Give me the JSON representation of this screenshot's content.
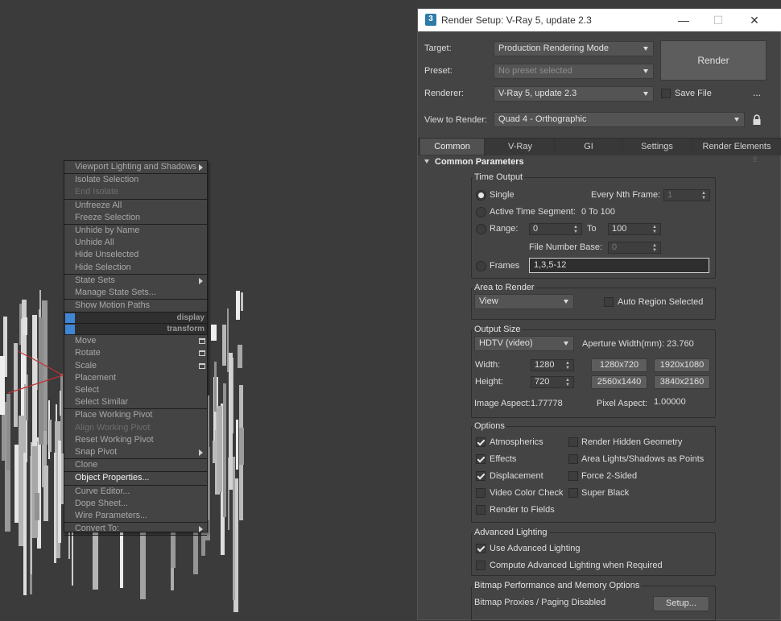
{
  "context_menu": {
    "sections": [
      [
        {
          "label": "Viewport Lighting and Shadows",
          "state": "normal",
          "arrow": true
        }
      ],
      [
        {
          "label": "Isolate Selection",
          "state": "normal"
        },
        {
          "label": "End Isolate",
          "state": "disabled"
        }
      ],
      [
        {
          "label": "Unfreeze All",
          "state": "normal"
        },
        {
          "label": "Freeze Selection",
          "state": "normal"
        }
      ],
      [
        {
          "label": "Unhide by Name",
          "state": "normal"
        },
        {
          "label": "Unhide All",
          "state": "normal"
        },
        {
          "label": "Hide Unselected",
          "state": "normal"
        },
        {
          "label": "Hide Selection",
          "state": "normal"
        }
      ],
      [
        {
          "label": "State Sets",
          "state": "normal",
          "arrow": true
        },
        {
          "label": "Manage State Sets...",
          "state": "normal"
        }
      ],
      [
        {
          "label": "Show Motion Paths",
          "state": "normal"
        }
      ]
    ],
    "band_display": "display",
    "band_transform": "transform",
    "sections2": [
      [
        {
          "label": "Move",
          "state": "normal",
          "box": true
        },
        {
          "label": "Rotate",
          "state": "normal",
          "box": true
        },
        {
          "label": "Scale",
          "state": "normal",
          "box": true
        },
        {
          "label": "Placement",
          "state": "normal"
        },
        {
          "label": "Select",
          "state": "normal"
        },
        {
          "label": "Select Similar",
          "state": "normal"
        }
      ],
      [
        {
          "label": "Place Working Pivot",
          "state": "normal"
        },
        {
          "label": "Align Working Pivot",
          "state": "disabled"
        },
        {
          "label": "Reset Working Pivot",
          "state": "normal"
        },
        {
          "label": "Snap Pivot",
          "state": "normal",
          "arrow": true
        }
      ],
      [
        {
          "label": "Clone",
          "state": "normal"
        }
      ],
      [
        {
          "label": "Object Properties...",
          "state": "highlight"
        }
      ],
      [
        {
          "label": "Curve Editor...",
          "state": "normal"
        },
        {
          "label": "Dope Sheet...",
          "state": "normal"
        },
        {
          "label": "Wire Parameters...",
          "state": "normal"
        }
      ],
      [
        {
          "label": "Convert To:",
          "state": "normal",
          "arrow": true
        }
      ]
    ]
  },
  "dialog": {
    "app_icon": "3",
    "title": "Render Setup: V-Ray 5, update 2.3",
    "win_min": "—",
    "win_max": "☐",
    "win_close": "✕",
    "target_label": "Target:",
    "target_value": "Production Rendering Mode",
    "preset_label": "Preset:",
    "preset_value": "No preset selected",
    "renderer_label": "Renderer:",
    "renderer_value": "V-Ray 5, update 2.3",
    "render_button": "Render",
    "save_file_label": "Save File",
    "more_button": "...",
    "view_label": "View to Render:",
    "view_value": "Quad 4 - Orthographic",
    "tabs": [
      "Common",
      "V-Ray",
      "GI",
      "Settings",
      "Render Elements"
    ],
    "rollout_title": "Common Parameters",
    "time_output": {
      "title": "Time Output",
      "single": "Single",
      "every_nth": "Every Nth Frame:",
      "every_nth_value": "1",
      "active_segment": "Active Time Segment:",
      "active_segment_value": "0 To 100",
      "range": "Range:",
      "range_from": "0",
      "range_to_label": "To",
      "range_to": "100",
      "file_number_base": "File Number Base:",
      "file_number_base_value": "0",
      "frames": "Frames",
      "frames_value": "1,3,5-12"
    },
    "area_to_render": {
      "title": "Area to Render",
      "value": "View",
      "auto_region": "Auto Region Selected"
    },
    "output_size": {
      "title": "Output Size",
      "preset": "HDTV (video)",
      "aperture": "Aperture Width(mm): 23.760",
      "width_label": "Width:",
      "width": "1280",
      "height_label": "Height:",
      "height": "720",
      "presets": [
        "1280x720",
        "1920x1080",
        "2560x1440",
        "3840x2160"
      ],
      "image_aspect_label": "Image Aspect:",
      "image_aspect": "1.77778",
      "pixel_aspect_label": "Pixel Aspect:",
      "pixel_aspect": "1.00000"
    },
    "options": {
      "title": "Options",
      "atmospherics": "Atmospherics",
      "render_hidden": "Render Hidden Geometry",
      "effects": "Effects",
      "area_lights": "Area Lights/Shadows as Points",
      "displacement": "Displacement",
      "force_2_sided": "Force 2-Sided",
      "video_color_check": "Video Color Check",
      "super_black": "Super Black",
      "render_to_fields": "Render to Fields"
    },
    "advanced_lighting": {
      "title": "Advanced Lighting",
      "use": "Use Advanced Lighting",
      "compute": "Compute Advanced Lighting when Required"
    },
    "bitmap": {
      "title": "Bitmap Performance and Memory Options",
      "status": "Bitmap Proxies / Paging Disabled",
      "setup": "Setup..."
    }
  }
}
